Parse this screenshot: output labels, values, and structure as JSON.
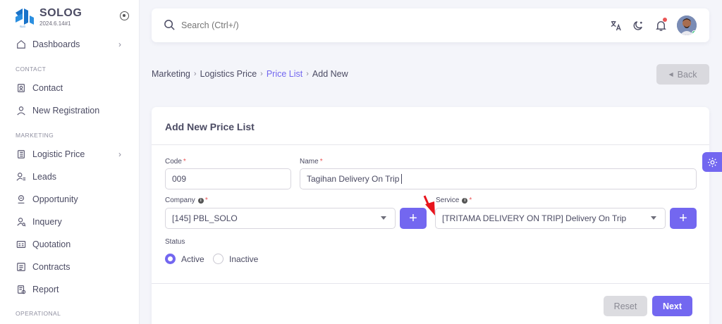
{
  "brand": {
    "name": "SOLOG",
    "version": "2024.6.14#1"
  },
  "sidebar": {
    "sections": [
      {
        "title": ""
      },
      {
        "title": "CONTACT"
      },
      {
        "title": "MARKETING"
      },
      {
        "title": "OPERATIONAL"
      }
    ],
    "items": [
      {
        "label": "Dashboards",
        "icon": "home-icon",
        "chevron": true
      },
      {
        "label": "Contact",
        "icon": "contact-card-icon"
      },
      {
        "label": "New Registration",
        "icon": "user-icon"
      },
      {
        "label": "Logistic Price",
        "icon": "list-icon",
        "chevron": true
      },
      {
        "label": "Leads",
        "icon": "user-list-icon"
      },
      {
        "label": "Opportunity",
        "icon": "handshake-icon"
      },
      {
        "label": "Inquery",
        "icon": "user-search-icon"
      },
      {
        "label": "Quotation",
        "icon": "id-card-icon"
      },
      {
        "label": "Contracts",
        "icon": "document-icon"
      },
      {
        "label": "Report",
        "icon": "report-icon"
      }
    ]
  },
  "search": {
    "placeholder": "Search (Ctrl+/)"
  },
  "breadcrumb": {
    "items": [
      "Marketing",
      "Logistics Price",
      "Price List",
      "Add New"
    ],
    "separator": "›"
  },
  "header": {
    "back_label": "Back"
  },
  "form": {
    "title": "Add New Price List",
    "code": {
      "label": "Code",
      "value": "009"
    },
    "name": {
      "label": "Name",
      "value": "Tagihan Delivery On Trip"
    },
    "company": {
      "label": "Company",
      "value": "[145] PBL_SOLO"
    },
    "service": {
      "label": "Service",
      "value": "[TRITAMA DELIVERY ON TRIP] Delivery On Trip"
    },
    "required_mark": "*",
    "info_mark": "i",
    "plus": "+",
    "status": {
      "label": "Status",
      "options": [
        {
          "label": "Active",
          "checked": true
        },
        {
          "label": "Inactive",
          "checked": false
        }
      ]
    },
    "reset_label": "Reset",
    "next_label": "Next"
  },
  "colors": {
    "primary": "#7367f0",
    "danger": "#ea5455",
    "success": "#28c76f"
  }
}
